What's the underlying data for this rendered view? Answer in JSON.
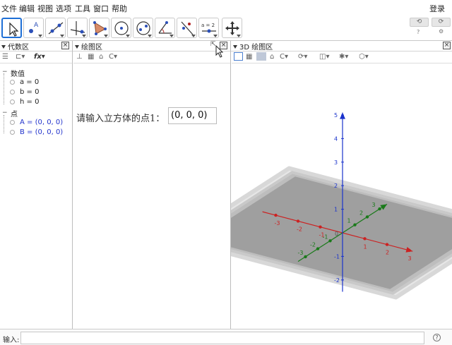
{
  "menu": {
    "items": [
      "文件",
      "编辑",
      "视图",
      "选项",
      "工具",
      "窗口",
      "帮助"
    ],
    "login": "登录"
  },
  "toolbar": {
    "tools": [
      {
        "name": "move-tool-icon",
        "selected": true
      },
      {
        "name": "point-tool-icon",
        "label": "A"
      },
      {
        "name": "line-tool-icon"
      },
      {
        "name": "perpendicular-tool-icon"
      },
      {
        "name": "polygon-tool-icon"
      },
      {
        "name": "circle-tool-icon"
      },
      {
        "name": "ellipse-tool-icon"
      },
      {
        "name": "angle-tool-icon"
      },
      {
        "name": "reflect-tool-icon"
      },
      {
        "name": "slider-tool-icon",
        "label": "a = 2"
      },
      {
        "name": "move-graphics-view-icon"
      }
    ],
    "undo": "⟲",
    "redo": "⟳",
    "help": "?",
    "settings": "⚙"
  },
  "algebra": {
    "title": "代数区",
    "groups": [
      {
        "label": "数值",
        "items": [
          "a = 0",
          "b = 0",
          "h = 0"
        ]
      },
      {
        "label": "点",
        "items": [
          "A = (0, 0, 0)",
          "B = (0, 0, 0)"
        ]
      }
    ]
  },
  "graphics": {
    "title": "绘图区",
    "prompt_label": "请输入立方体的点1：",
    "prompt_value": "(0, 0, 0)"
  },
  "graphics3d": {
    "title": "3D 绘图区"
  },
  "chart_data": {
    "type": "scatter",
    "x_axis_ticks": [
      "-3",
      "-2",
      "-1",
      "1",
      "2",
      "3"
    ],
    "y_axis_ticks": [
      "-3",
      "-2",
      "-1",
      "1",
      "2",
      "3"
    ],
    "z_axis_ticks": [
      "-2",
      "-1",
      "1",
      "2",
      "3",
      "4",
      "5"
    ],
    "origin_label": "0",
    "colors": {
      "x": "#cc2222",
      "y": "#1a7a1a",
      "z": "#1a33cc",
      "plane": "#9a9a9a"
    }
  },
  "inputbar": {
    "label": "输入:",
    "help": "?"
  },
  "colors": {
    "accent": "#1e6fd6",
    "algebra_blue": "#2233cc"
  }
}
